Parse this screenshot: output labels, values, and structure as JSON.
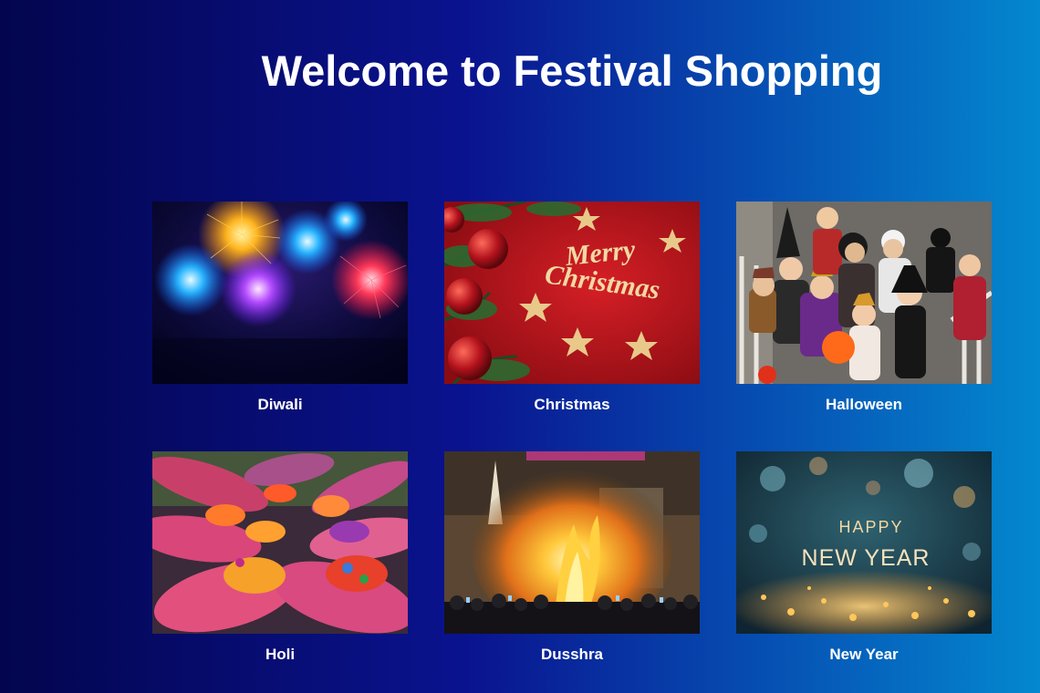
{
  "page": {
    "title": "Welcome to Festival Shopping"
  },
  "festivals": [
    {
      "label": "Diwali",
      "image_desc": "fireworks-photo"
    },
    {
      "label": "Christmas",
      "image_desc": "merry-christmas-card-photo",
      "image_text": [
        "Merry",
        "Christmas"
      ]
    },
    {
      "label": "Halloween",
      "image_desc": "children-in-costumes-photo"
    },
    {
      "label": "Holi",
      "image_desc": "colored-powder-hands-photo"
    },
    {
      "label": "Dusshra",
      "image_desc": "bonfire-crowd-photo"
    },
    {
      "label": "New Year",
      "image_desc": "happy-new-year-sparkles-photo",
      "image_text": [
        "HAPPY",
        "NEW YEAR"
      ]
    }
  ],
  "colors": {
    "bg_left": "#03054e",
    "bg_right": "#0488cf",
    "text": "#ffffff"
  }
}
